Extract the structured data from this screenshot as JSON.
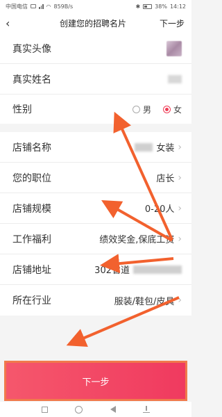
{
  "status_bar": {
    "carrier": "中国电信",
    "speed": "859B/s",
    "battery": "38%",
    "time": "14:12"
  },
  "header": {
    "back_icon": "chevron-left-icon",
    "title": "创建您的招聘名片",
    "next_label": "下一步"
  },
  "personal": {
    "avatar_label": "真实头像",
    "name_label": "真实姓名",
    "name_value_hint": "人",
    "gender_label": "性别",
    "gender_options": [
      "男",
      "女"
    ],
    "gender_selected": "女"
  },
  "store": {
    "name_label": "店铺名称",
    "name_value": "女装",
    "position_label": "您的职位",
    "position_value": "店长",
    "size_label": "店铺规模",
    "size_value": "0-20人",
    "welfare_label": "工作福利",
    "welfare_value": "绩效奖金,保底工资",
    "address_label": "店铺地址",
    "address_value": "302省道",
    "industry_label": "所在行业",
    "industry_value": "服装/鞋包/皮具"
  },
  "footer": {
    "next_button": "下一步"
  },
  "colors": {
    "accent": "#ef3b55",
    "annotation": "#f2612e"
  }
}
